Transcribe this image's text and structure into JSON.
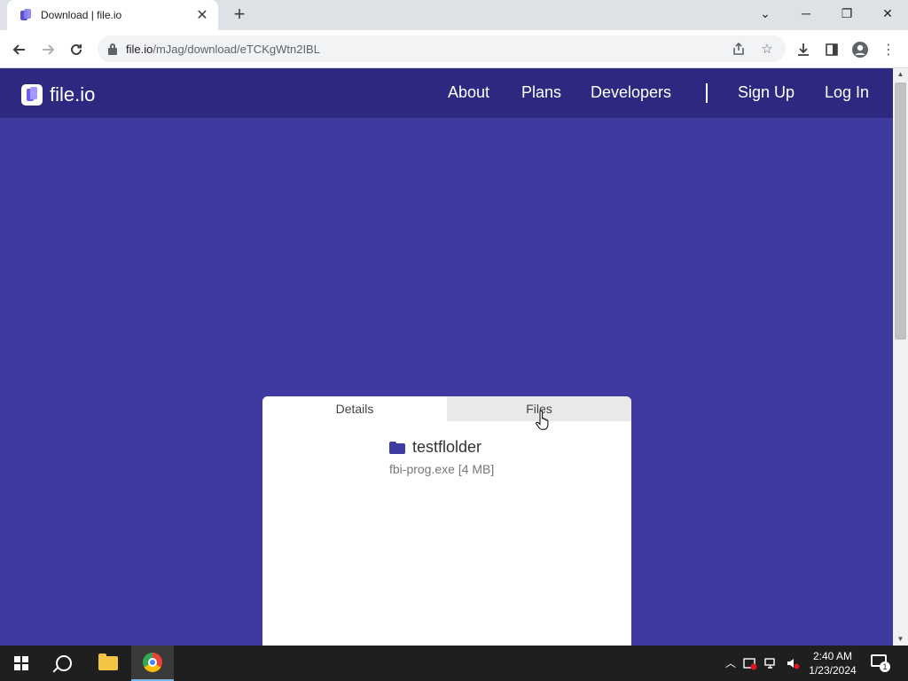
{
  "browser": {
    "tab_title": "Download | file.io",
    "tab_close": "✕",
    "new_tab": "+",
    "url_host": "file.io",
    "url_path": "/mJag/download/eTCKgWtn2IBL",
    "window_controls": {
      "list": "⌄",
      "minimize": "─",
      "restore": "❐",
      "close": "✕"
    }
  },
  "site": {
    "logo_text": "file.io",
    "nav": {
      "about": "About",
      "plans": "Plans",
      "developers": "Developers",
      "sign_up": "Sign Up",
      "log_in": "Log In"
    },
    "card": {
      "tabs": [
        "Details",
        "Files"
      ],
      "active_tab": "Details",
      "folder_name": "testflolder",
      "file_entry": "fbi-prog.exe [4 MB]"
    }
  },
  "taskbar": {
    "time": "2:40 AM",
    "date": "1/23/2024",
    "notification_count": "1"
  },
  "colors": {
    "page_bg": "#3f3aa0",
    "header_bg": "#2d2980",
    "accent": "#3f3aa0"
  }
}
